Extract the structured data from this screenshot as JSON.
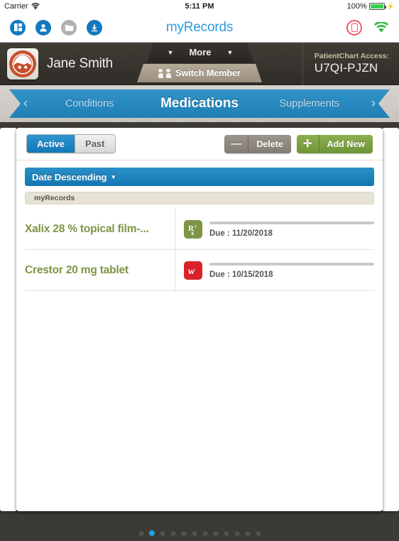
{
  "status_bar": {
    "carrier": "Carrier",
    "wifi_icon": "wifi-icon",
    "time": "5:11 PM",
    "battery_percent": "100%",
    "battery_icon": "battery-full-icon",
    "charging_icon": "lightning-bolt-icon"
  },
  "app_toolbar": {
    "title": "myRecords",
    "icons": [
      {
        "name": "dashboard-icon",
        "glyph": "▤",
        "color": "#1379bf"
      },
      {
        "name": "profile-icon",
        "glyph": "●",
        "color": "#1379bf"
      },
      {
        "name": "folder-icon",
        "glyph": "▭",
        "color": "#b0b0b0"
      },
      {
        "name": "download-icon",
        "glyph": "↓",
        "color": "#1379bf"
      }
    ],
    "alert_icon": "alert-record-icon",
    "alert_color": "#f4566a",
    "wifi_icon": "wifi-connected-icon",
    "wifi_color": "#38b54a"
  },
  "member_bar": {
    "avatar_icon": "member-avatar-icon",
    "avatar_color": "#c7502c",
    "member_name": "Jane Smith",
    "more_tab_label": "More",
    "switch_member_label": "Switch Member",
    "switch_member_icon": "people-icon",
    "access_label": "PatientChart Access:",
    "access_code": "U7QI-PJZN"
  },
  "ribbon_nav": {
    "prev_arrow": "‹",
    "prev_label": "Conditions",
    "current_label": "Medications",
    "next_label": "Supplements",
    "next_arrow": "›",
    "accent_color": "#1b7cb2"
  },
  "panel": {
    "segments": [
      {
        "label": "Active",
        "selected": true
      },
      {
        "label": "Past",
        "selected": false
      }
    ],
    "delete_button": {
      "label": "Delete",
      "glyph": "—",
      "icon": "minus-icon"
    },
    "add_button": {
      "label": "Add New",
      "glyph": "✛",
      "icon": "plus-icon"
    },
    "sort_label": "Date Descending",
    "sort_caret": "▾",
    "group_header": "myRecords",
    "rows": [
      {
        "name": "Xalix 28 % topical film-...",
        "pharmacy_icon": "rx-prescription-icon",
        "pharmacy_glyph": "R",
        "pharmacy_color": "#7d9545",
        "due": "Due : 11/20/2018"
      },
      {
        "name": "Crestor 20 mg tablet",
        "pharmacy_icon": "walgreens-logo-icon",
        "pharmacy_glyph": "w",
        "pharmacy_color": "#d8232a",
        "due": "Due : 10/15/2018"
      }
    ]
  },
  "pagination": {
    "total": 12,
    "active_index": 1,
    "active_color": "#1fa3e0"
  }
}
